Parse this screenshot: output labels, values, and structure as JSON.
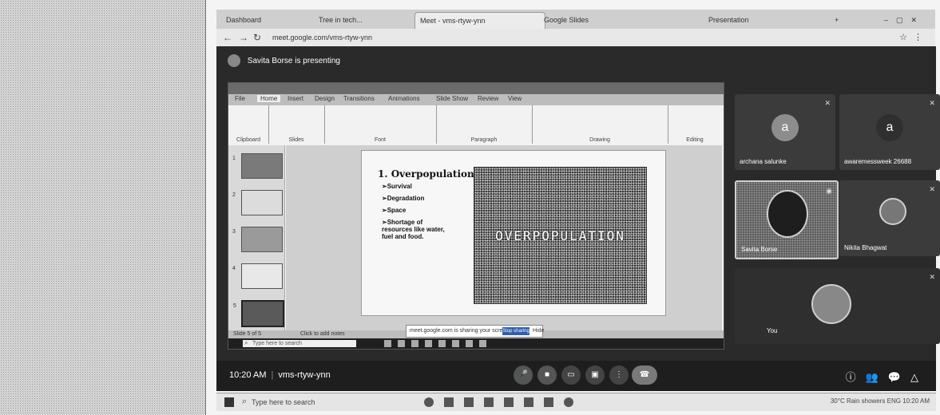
{
  "browser": {
    "tabs": [
      "Dashboard",
      "Tree in tech...",
      "Meet - vms-rtyw-ynn",
      "Google Slides",
      "Presentation"
    ],
    "url": "meet.google.com/vms-rtyw-ynn"
  },
  "meet": {
    "presenter_label": "Savita Borse is presenting",
    "meeting_time": "10:20 AM",
    "meeting_code": "vms-rtyw-ynn"
  },
  "ppt": {
    "ribbon_tabs": [
      "File",
      "Home",
      "Insert",
      "Design",
      "Transitions",
      "Animations",
      "Slide Show",
      "Review",
      "View"
    ],
    "ribbon_groups": [
      "Clipboard",
      "Slides",
      "Font",
      "Paragraph",
      "Drawing",
      "Editing"
    ],
    "slide_numbers": [
      "1",
      "2",
      "3",
      "4",
      "5"
    ],
    "slide_heading": "1. Overpopulation",
    "bullets": [
      "➢Survival",
      "➢Degradation",
      "➢Space",
      "➢Shortage of resources like water, fuel and food."
    ],
    "image_text": "OVERPOPULATION",
    "status_left": "Slide 5 of 5",
    "status_mid": "Click to add notes",
    "popup_text": "meet.google.com is sharing your screen.",
    "popup_button": "Stop sharing",
    "popup_hide": "Hide",
    "inner_search": "Type here to search"
  },
  "participants": [
    {
      "name": "archana salunke",
      "initial": "a"
    },
    {
      "name": "awaremessweek 26688",
      "initial": "a"
    },
    {
      "name": "Savita Borse"
    },
    {
      "name": "Nikita Bhagwat"
    },
    {
      "name": "You"
    }
  ],
  "taskbar": {
    "search_placeholder": "Type here to search",
    "tray_text": "30°C  Rain showers   ENG  10:20 AM"
  }
}
